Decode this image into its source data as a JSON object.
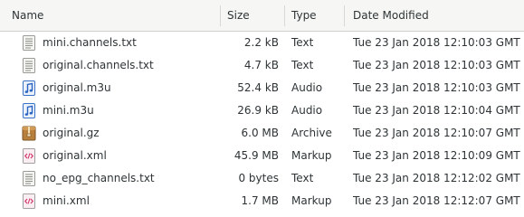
{
  "columns": {
    "name": "Name",
    "size": "Size",
    "type": "Type",
    "date": "Date Modified"
  },
  "files": [
    {
      "name": "mini.channels.txt",
      "size": "2.2 kB",
      "type": "Text",
      "date": "Tue 23 Jan 2018 12:10:03 GMT",
      "icon": "text-file-icon"
    },
    {
      "name": "original.channels.txt",
      "size": "4.7 kB",
      "type": "Text",
      "date": "Tue 23 Jan 2018 12:10:03 GMT",
      "icon": "text-file-icon"
    },
    {
      "name": "original.m3u",
      "size": "52.4 kB",
      "type": "Audio",
      "date": "Tue 23 Jan 2018 12:10:03 GMT",
      "icon": "audio-file-icon"
    },
    {
      "name": "mini.m3u",
      "size": "26.9 kB",
      "type": "Audio",
      "date": "Tue 23 Jan 2018 12:10:04 GMT",
      "icon": "audio-file-icon"
    },
    {
      "name": "original.gz",
      "size": "6.0 MB",
      "type": "Archive",
      "date": "Tue 23 Jan 2018 12:10:07 GMT",
      "icon": "archive-file-icon"
    },
    {
      "name": "original.xml",
      "size": "45.9 MB",
      "type": "Markup",
      "date": "Tue 23 Jan 2018 12:10:09 GMT",
      "icon": "markup-file-icon"
    },
    {
      "name": "no_epg_channels.txt",
      "size": "0 bytes",
      "type": "Text",
      "date": "Tue 23 Jan 2018 12:12:02 GMT",
      "icon": "text-file-icon"
    },
    {
      "name": "mini.xml",
      "size": "1.7 MB",
      "type": "Markup",
      "date": "Tue 23 Jan 2018 12:12:07 GMT",
      "icon": "markup-file-icon"
    }
  ]
}
